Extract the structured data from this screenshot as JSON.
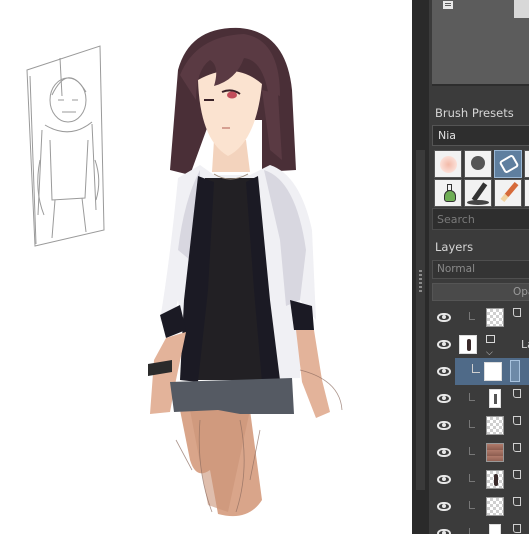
{
  "brush_presets": {
    "title": "Brush Presets",
    "preset_name": "Nia",
    "search_placeholder": "Search",
    "items": [
      {
        "icon": "soft-round-brush-icon"
      },
      {
        "icon": "hard-round-brush-icon"
      },
      {
        "icon": "airbrush-selected-icon",
        "selected": true
      },
      {
        "icon": "brush-partial-icon"
      },
      {
        "icon": "flask-brush-icon"
      },
      {
        "icon": "pen-brush-icon"
      },
      {
        "icon": "pencil-brush-icon"
      },
      {
        "icon": "brush-partial-icon"
      }
    ]
  },
  "layers": {
    "title": "Layers",
    "blend_mode": "Normal",
    "opacity_label": "Opa",
    "rows": [
      {
        "thumb": "checker",
        "kind": "layer"
      },
      {
        "thumb": "figure",
        "kind": "group",
        "name": "La"
      },
      {
        "thumb": "white",
        "kind": "layer",
        "selected": true
      },
      {
        "thumb": "figure-small",
        "kind": "layer"
      },
      {
        "thumb": "checker",
        "kind": "layer"
      },
      {
        "thumb": "brown",
        "kind": "layer"
      },
      {
        "thumb": "figure",
        "kind": "layer"
      },
      {
        "thumb": "checker",
        "kind": "layer"
      },
      {
        "thumb": "figure-small",
        "kind": "layer"
      }
    ]
  },
  "colors": {
    "panel_bg": "#3b3b3b",
    "selection": "#4f6a88",
    "canvas": "#ffffff"
  }
}
